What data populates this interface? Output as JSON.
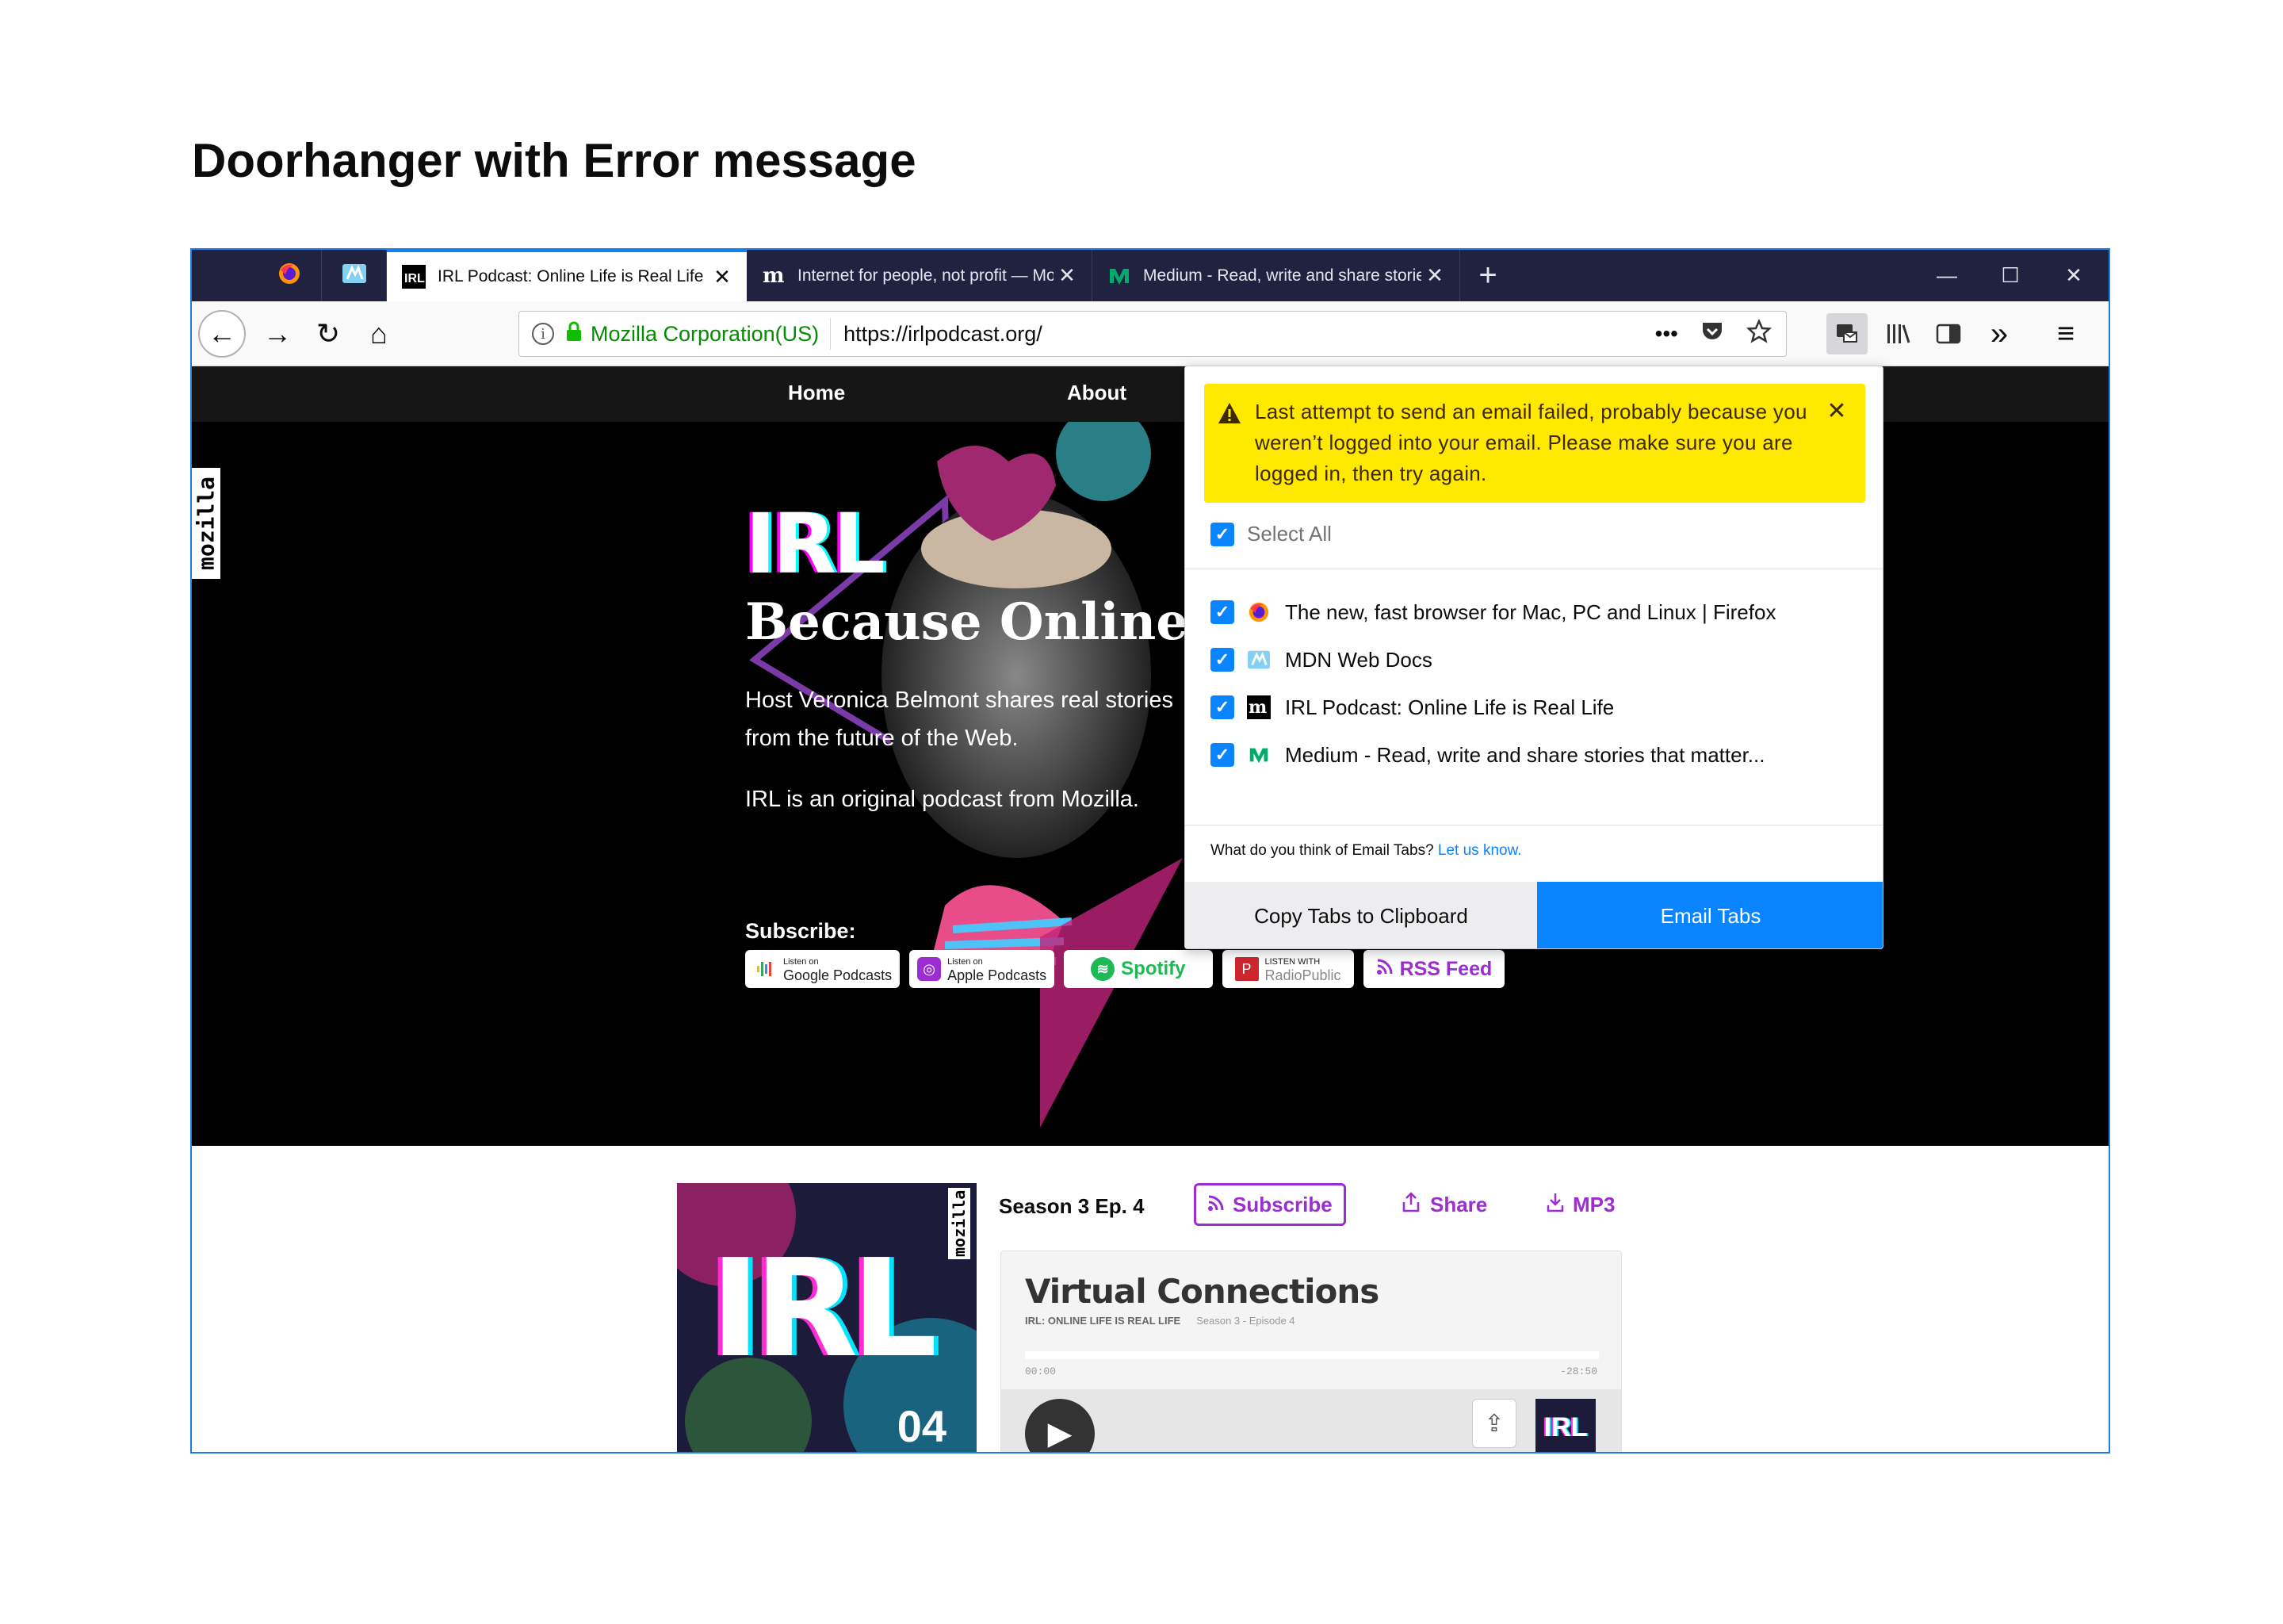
{
  "page_title": "Doorhanger with Error message",
  "browser": {
    "tabs": [
      {
        "title": "IRL Podcast: Online Life is Real Life",
        "icon": "irl-favicon",
        "selected": true
      },
      {
        "title": "Internet for people, not profit — Mozilla",
        "icon": "mozilla-m-favicon"
      },
      {
        "title": "Medium - Read, write and share stories",
        "icon": "medium-favicon"
      }
    ],
    "pinned_tabs": [
      "firefox-favicon",
      "mdn-favicon"
    ],
    "new_tab": "+",
    "window_controls": {
      "minimize": "—",
      "maximize": "☐",
      "close": "✕"
    },
    "nav": {
      "back": "←",
      "forward": "→",
      "reload": "↻",
      "home": "⌂",
      "identity": "Mozilla Corporation(US)",
      "url": "https://irlpodcast.org/",
      "page_actions": "•••",
      "pocket_icon": "pocket-icon",
      "bookmark_icon": "star-icon"
    },
    "toolbar": {
      "email_tabs_icon": "email-tabs-icon",
      "library_icon": "library-icon",
      "sidebar_icon": "sidebar-icon",
      "overflow": "»",
      "menu": "≡"
    }
  },
  "site": {
    "nav": {
      "home": "Home",
      "about": "About"
    },
    "side_logo": "mozilla",
    "logo": "IRL",
    "title": "Because Online Life is Real Life",
    "description": "Host Veronica Belmont shares real stories from the future of the Web.",
    "original": "IRL is an original podcast from Mozilla.",
    "subscribe_label": "Subscribe:",
    "badges": [
      {
        "small": "Listen on",
        "label": "Google Podcasts"
      },
      {
        "small": "Listen on",
        "label": "Apple Podcasts"
      },
      {
        "label": "Spotify"
      },
      {
        "small": "LISTEN WITH",
        "label": "RadioPublic"
      },
      {
        "label": "RSS Feed"
      }
    ],
    "cover": {
      "logo": "IRL",
      "side": "mozilla",
      "number": "04"
    },
    "episode": "Season 3 Ep. 4",
    "buttons": {
      "subscribe": "Subscribe",
      "share": "Share",
      "mp3": "MP3"
    },
    "player": {
      "title": "Virtual Connections",
      "show": "IRL: ONLINE LIFE IS REAL LIFE",
      "season": "Season 3 - Episode 4",
      "time_start": "00:00",
      "time_end": "-28:50",
      "thumb": "IRL"
    }
  },
  "doorhanger": {
    "error": "Last attempt to send an email failed, probably because you weren’t logged into your email. Please make sure you are logged in, then try again.",
    "error_close": "✕",
    "select_all": "Select All",
    "tabs": [
      {
        "title": "The new, fast browser for Mac, PC and Linux | Firefox",
        "icon": "firefox-favicon",
        "checked": true
      },
      {
        "title": "MDN Web Docs",
        "icon": "mdn-favicon",
        "checked": true
      },
      {
        "title": "IRL Podcast: Online Life is Real Life",
        "icon": "mozilla-m-favicon",
        "checked": true
      },
      {
        "title": "Medium - Read, write and share stories that matter...",
        "icon": "medium-favicon",
        "checked": true
      }
    ],
    "feedback_text": "What do you think of Email Tabs?",
    "feedback_link": "Let us know.",
    "copy_button": "Copy Tabs to Clipboard",
    "email_button": "Email Tabs"
  },
  "colors": {
    "accent": "#0a84ff",
    "error_bg": "#ffe900",
    "tabstrip": "#212240",
    "podcast_purple": "#9b2dd1",
    "secure_green": "#058b00"
  }
}
